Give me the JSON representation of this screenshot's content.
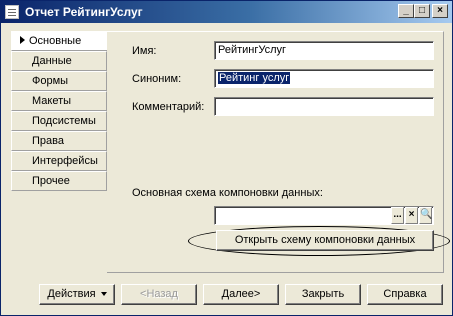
{
  "window": {
    "title": "Отчет РейтингУслуг",
    "minimize_glyph": "_",
    "maximize_glyph": "□",
    "close_glyph": "×"
  },
  "tabs": [
    "Основные",
    "Данные",
    "Формы",
    "Макеты",
    "Подсистемы",
    "Права",
    "Интерфейсы",
    "Прочее"
  ],
  "active_tab": "Основные",
  "form": {
    "name_label": "Имя:",
    "name_value": "РейтингУслуг",
    "synonym_label": "Синоним:",
    "synonym_value": "Рейтинг услуг",
    "comment_label": "Комментарий:",
    "comment_value": "",
    "schema_label": "Основная схема компоновки данных:",
    "schema_value": "",
    "schema_buttons": [
      "...",
      "×",
      "🔍"
    ],
    "open_schema_button": "Открыть схему компоновки данных"
  },
  "footer": {
    "actions": "Действия",
    "back": "<Назад",
    "next": "Далее>",
    "close": "Закрыть",
    "help": "Справка"
  }
}
